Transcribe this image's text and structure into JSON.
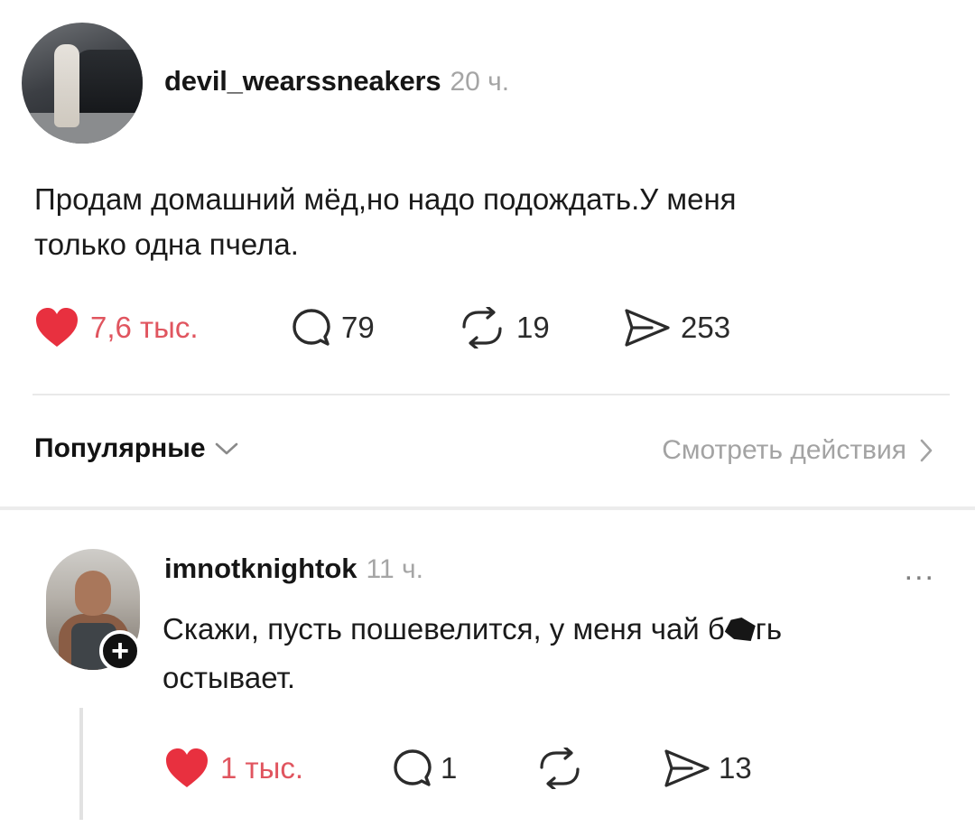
{
  "post": {
    "username": "devil_wearssneakers",
    "time": "20 ч.",
    "text_line1": "Продам домашний мёд,но надо подождать.У меня",
    "text_line2": "только одна пчела.",
    "likes": "7,6 тыс.",
    "comments": "79",
    "reposts": "19",
    "shares": "253"
  },
  "replies_header": {
    "sort_label": "Популярные",
    "view_activity": "Смотреть действия"
  },
  "comment": {
    "username": "imnotknightok",
    "time": "11 ч.",
    "text_before_censor": "Скажи, пусть пошевелится, у меня чай б",
    "text_after_censor": "гь",
    "text_line2": "остывает.",
    "likes": "1 тыс.",
    "comments": "1",
    "shares": "13",
    "more": "..."
  },
  "colors": {
    "like_red": "#e8303f",
    "muted_text": "#a5a5a5"
  },
  "icons": {
    "like": "heart-filled-icon",
    "comment": "speech-bubble-icon",
    "repost": "repost-arrows-icon",
    "share": "paper-plane-icon",
    "follow": "plus-icon",
    "sort": "chevron-down-icon",
    "view": "chevron-right-icon"
  }
}
